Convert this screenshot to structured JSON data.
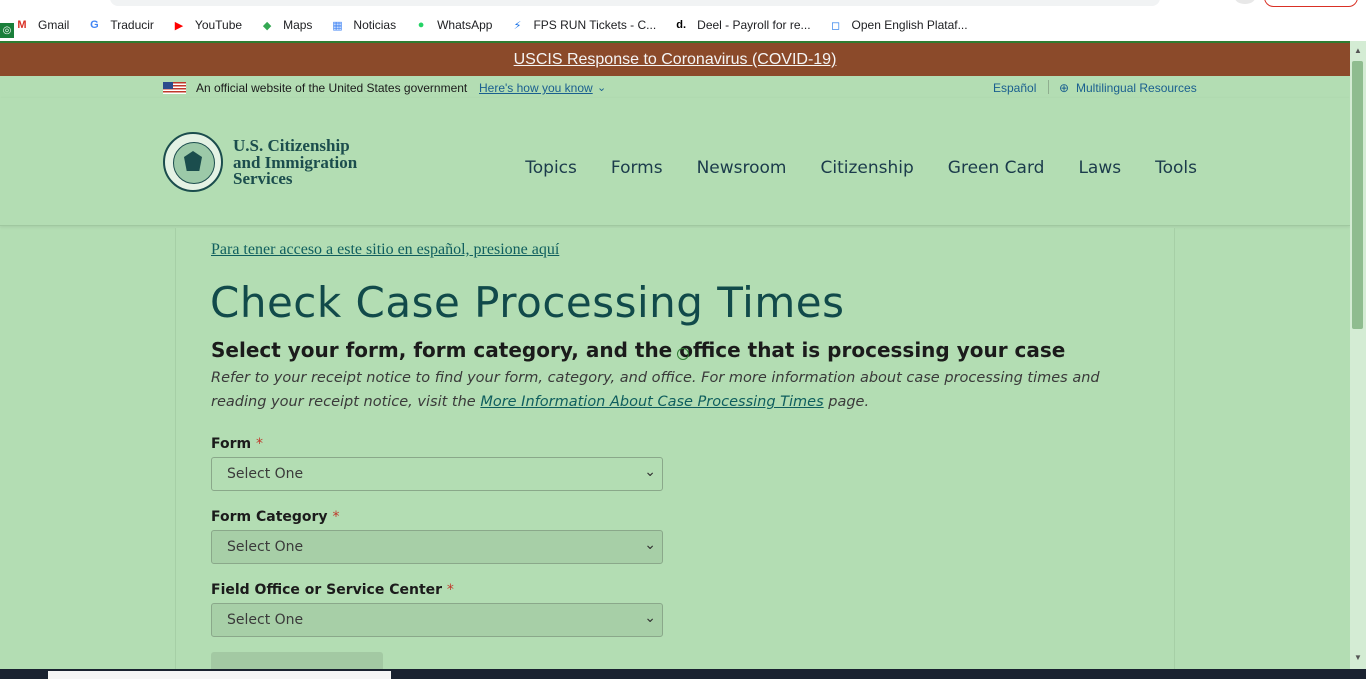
{
  "browser": {
    "bookmarks": [
      {
        "label": "Gmail",
        "icon": "gmail-icon",
        "glyph": "M",
        "color": "#d93025"
      },
      {
        "label": "Traducir",
        "icon": "translate-icon",
        "glyph": "G",
        "color": "#4285f4"
      },
      {
        "label": "YouTube",
        "icon": "youtube-icon",
        "glyph": "▶",
        "color": "#ff0000"
      },
      {
        "label": "Maps",
        "icon": "maps-icon",
        "glyph": "◆",
        "color": "#34a853"
      },
      {
        "label": "Noticias",
        "icon": "news-icon",
        "glyph": "▦",
        "color": "#4285f4"
      },
      {
        "label": "WhatsApp",
        "icon": "whatsapp-icon",
        "glyph": "●",
        "color": "#25d366"
      },
      {
        "label": "FPS RUN Tickets - C...",
        "icon": "lightning-icon",
        "glyph": "⚡",
        "color": "#1a73e8"
      },
      {
        "label": "Deel - Payroll for re...",
        "icon": "deel-icon",
        "glyph": "d.",
        "color": "#000000"
      },
      {
        "label": "Open English Plataf...",
        "icon": "open-english-icon",
        "glyph": "◻",
        "color": "#1a73e8"
      }
    ]
  },
  "covid_banner": {
    "text": "USCIS Response to Coronavirus (COVID-19)"
  },
  "gov_banner": {
    "official": "An official website of the United States government",
    "how_you_know": "Here's how you know",
    "espanol": "Español",
    "multilingual": "Multilingual Resources"
  },
  "header": {
    "agency_line1": "U.S. Citizenship",
    "agency_line2": "and Immigration",
    "agency_line3": "Services",
    "nav": [
      "Topics",
      "Forms",
      "Newsroom",
      "Citizenship",
      "Green Card",
      "Laws",
      "Tools"
    ]
  },
  "main": {
    "spanish_link": "Para tener acceso a este sitio en español, presione aquí",
    "title": "Check Case Processing Times",
    "subtitle": "Select your form, form category, and the office that is processing your case",
    "intro_before": "Refer to your receipt notice to find your form, category, and office. For more information about case processing times and reading your receipt notice, visit the ",
    "intro_link": "More Information About Case Processing Times",
    "intro_after": " page.",
    "fields": {
      "form": {
        "label": "Form",
        "value": "Select One"
      },
      "category": {
        "label": "Form Category",
        "value": "Select One"
      },
      "office": {
        "label": "Field Office or Service Center",
        "value": "Select One"
      }
    },
    "required_mark": "*"
  },
  "colors": {
    "covid_bar": "#8b4a2a",
    "page_bg": "#b3ddb3",
    "brand": "#1b4d4d",
    "link": "#1a5f8f"
  }
}
